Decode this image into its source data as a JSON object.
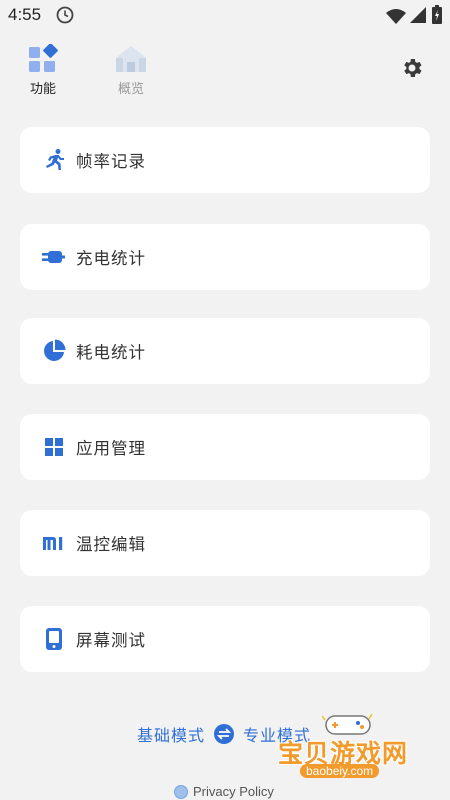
{
  "status_bar": {
    "time": "4:55"
  },
  "tabs": [
    {
      "label": "功能"
    },
    {
      "label": "概览"
    }
  ],
  "cards": [
    {
      "label": "帧率记录"
    },
    {
      "label": "充电统计"
    },
    {
      "label": "耗电统计"
    },
    {
      "label": "应用管理"
    },
    {
      "label": "温控编辑"
    },
    {
      "label": "屏幕测试"
    }
  ],
  "modes": {
    "basic": "基础模式",
    "pro": "专业模式"
  },
  "privacy": {
    "label": "Privacy Policy"
  },
  "watermark": {
    "title": "宝贝游戏网",
    "url": "baobeiy.com"
  },
  "colors": {
    "accent": "#2f6fd6",
    "background": "#f2f2f2",
    "card": "#ffffff",
    "watermark": "#f29a2b"
  },
  "icons": {
    "status": [
      "clock-icon",
      "wifi-icon",
      "signal-icon",
      "battery-icon"
    ],
    "tabs": [
      "features-icon",
      "overview-house-icon"
    ],
    "settings": "gear-icon",
    "cards": [
      "running-icon",
      "charger-plug-icon",
      "pie-chart-icon",
      "grid-apps-icon",
      "mi-logo-icon",
      "phone-screen-icon"
    ],
    "mode_switch": "swap-icon"
  }
}
